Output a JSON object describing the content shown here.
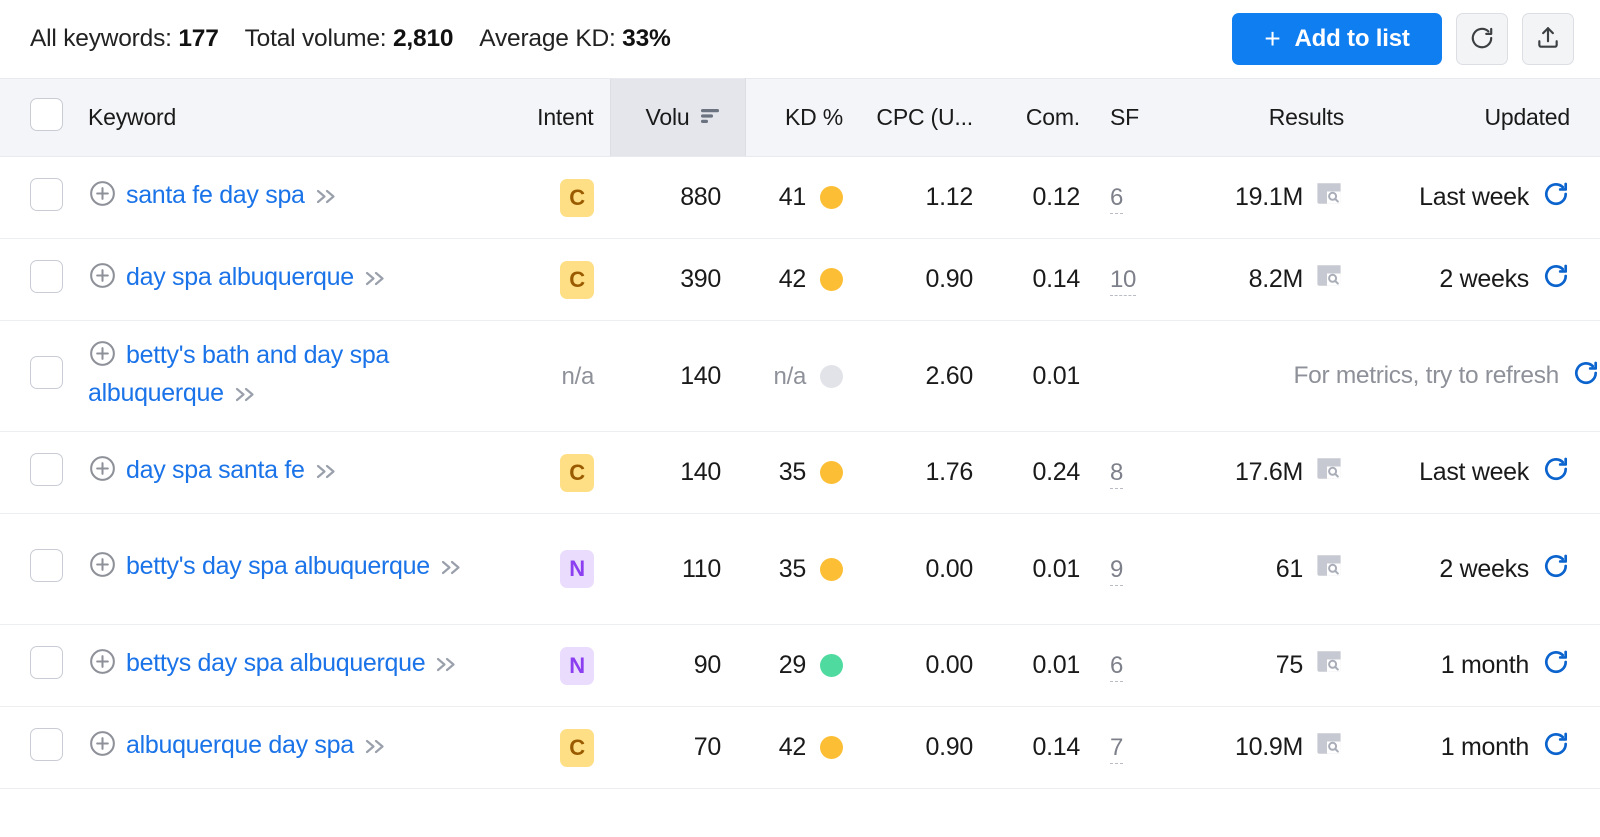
{
  "summary": {
    "all_keywords_label": "All keywords:",
    "all_keywords_value": "177",
    "total_volume_label": "Total volume:",
    "total_volume_value": "2,810",
    "average_kd_label": "Average KD:",
    "average_kd_value": "33%"
  },
  "actions": {
    "add_to_list_label": "Add to list",
    "add_to_list_plus": "+",
    "refresh_icon": "refresh-icon",
    "export_icon": "export-icon"
  },
  "colors": {
    "primary_blue": "#0f7ef1",
    "link_blue": "#1a73e8",
    "kd_orange": "#fcbe35",
    "kd_green": "#4fdba0",
    "kd_grey": "#e2e3e8",
    "badge_c_bg": "#ffdf85",
    "badge_c_fg": "#9a5b00",
    "badge_n_bg": "#eadcfd",
    "badge_n_fg": "#8b3ff0",
    "header_bg": "#f4f5f9",
    "sorted_col_bg": "#e4e6ec"
  },
  "table": {
    "columns": [
      {
        "key": "keyword",
        "label": "Keyword"
      },
      {
        "key": "intent",
        "label": "Intent"
      },
      {
        "key": "volume",
        "label": "Volu",
        "sorted": true,
        "sort_icon": "sort-descending-icon"
      },
      {
        "key": "kd",
        "label": "KD %"
      },
      {
        "key": "cpc",
        "label": "CPC (U..."
      },
      {
        "key": "com",
        "label": "Com."
      },
      {
        "key": "sf",
        "label": "SF"
      },
      {
        "key": "results",
        "label": "Results"
      },
      {
        "key": "updated",
        "label": "Updated"
      }
    ],
    "no_metrics_message": "For metrics, try to refresh",
    "rows": [
      {
        "keyword": "santa fe day spa",
        "intent": "C",
        "intent_type": "badge",
        "volume": "880",
        "kd": "41",
        "kd_color": "orange",
        "cpc": "1.12",
        "com": "0.12",
        "sf": "6",
        "results": "19.1M",
        "updated": "Last week",
        "has_metrics": true
      },
      {
        "keyword": "day spa albuquerque",
        "intent": "C",
        "intent_type": "badge",
        "volume": "390",
        "kd": "42",
        "kd_color": "orange",
        "cpc": "0.90",
        "com": "0.14",
        "sf": "10",
        "results": "8.2M",
        "updated": "2 weeks",
        "has_metrics": true
      },
      {
        "keyword": "betty's bath and day spa albuquerque",
        "intent": "n/a",
        "intent_type": "na",
        "volume": "140",
        "kd": "n/a",
        "kd_color": "grey",
        "cpc": "2.60",
        "com": "0.01",
        "sf": "",
        "results": "",
        "updated": "",
        "has_metrics": false
      },
      {
        "keyword": "day spa santa fe",
        "intent": "C",
        "intent_type": "badge",
        "volume": "140",
        "kd": "35",
        "kd_color": "orange",
        "cpc": "1.76",
        "com": "0.24",
        "sf": "8",
        "results": "17.6M",
        "updated": "Last week",
        "has_metrics": true
      },
      {
        "keyword": "betty's day spa albuquerque",
        "intent": "N",
        "intent_type": "badge",
        "volume": "110",
        "kd": "35",
        "kd_color": "orange",
        "cpc": "0.00",
        "com": "0.01",
        "sf": "9",
        "results": "61",
        "updated": "2 weeks",
        "has_metrics": true
      },
      {
        "keyword": "bettys day spa albuquerque",
        "intent": "N",
        "intent_type": "badge",
        "volume": "90",
        "kd": "29",
        "kd_color": "green",
        "cpc": "0.00",
        "com": "0.01",
        "sf": "6",
        "results": "75",
        "updated": "1 month",
        "has_metrics": true
      },
      {
        "keyword": "albuquerque day spa",
        "intent": "C",
        "intent_type": "badge",
        "volume": "70",
        "kd": "42",
        "kd_color": "orange",
        "cpc": "0.90",
        "com": "0.14",
        "sf": "7",
        "results": "10.9M",
        "updated": "1 month",
        "has_metrics": true
      }
    ]
  }
}
